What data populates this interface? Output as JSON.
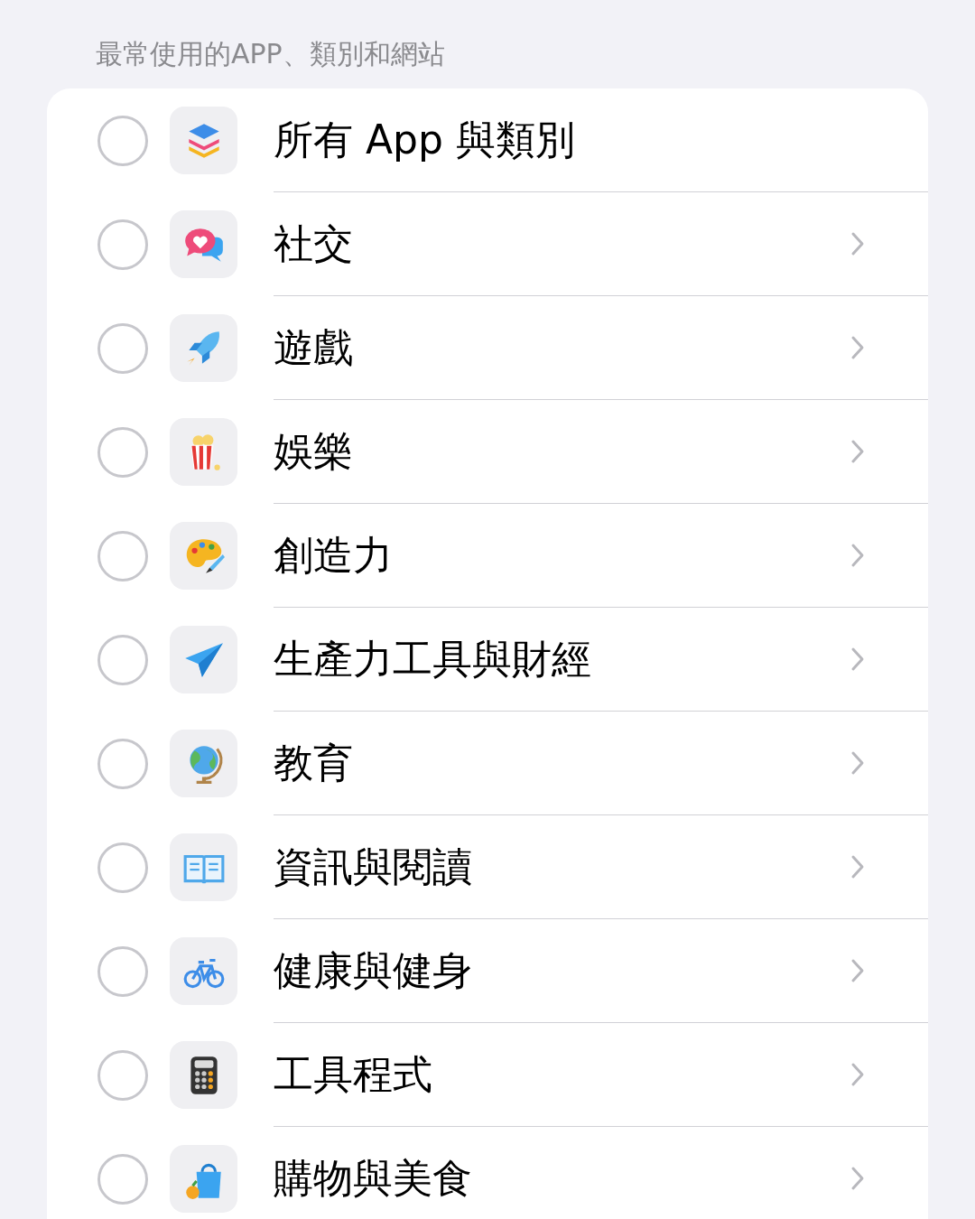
{
  "section_header": "最常使用的APP、類別和網站",
  "rows": [
    {
      "label": "所有 App 與類別",
      "selected": false,
      "chevron": false
    },
    {
      "label": "社交",
      "selected": false,
      "chevron": true
    },
    {
      "label": "遊戲",
      "selected": false,
      "chevron": true
    },
    {
      "label": "娛樂",
      "selected": false,
      "chevron": true
    },
    {
      "label": "創造力",
      "selected": false,
      "chevron": true
    },
    {
      "label": "生產力工具與財經",
      "selected": false,
      "chevron": true
    },
    {
      "label": "教育",
      "selected": false,
      "chevron": true
    },
    {
      "label": "資訊與閱讀",
      "selected": false,
      "chevron": true
    },
    {
      "label": "健康與健身",
      "selected": false,
      "chevron": true
    },
    {
      "label": "工具程式",
      "selected": false,
      "chevron": true
    },
    {
      "label": "購物與美食",
      "selected": false,
      "chevron": true
    }
  ]
}
